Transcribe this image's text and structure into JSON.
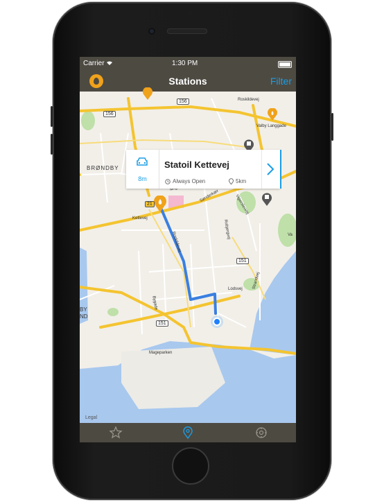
{
  "status_bar": {
    "carrier": "Carrier",
    "time": "1:30 PM"
  },
  "nav": {
    "title": "Stations",
    "filter_label": "Filter"
  },
  "map": {
    "labels": {
      "brondby": "BRØNDBY",
      "brondby_strand_1": "BY",
      "brondby_strand_2": "ND",
      "kettevej": "Kettevej",
      "roskildevej": "Roskildevej",
      "valby_langgade": "Valby Langgade",
      "sonderkaer": "Sønderkær",
      "vigerslevvej": "Vigerslevvej",
      "roskilde_mark": "Roskildevej",
      "lodsvej": "Lodsvej",
      "strandvej": "Strandvej",
      "bygade": "Bygade",
      "mageparken": "Mageparken",
      "va": "Va",
      "roblergvej": "Robjergvej",
      "llingevej": "llingevej"
    },
    "shields": {
      "r156a": "156",
      "r156b": "156",
      "r21": "21",
      "r151a": "151",
      "r151b": "151"
    },
    "legal": "Legal"
  },
  "station_card": {
    "name": "Statoil Kettevej",
    "travel_time": "8m",
    "status": "Always Open",
    "distance": "5km"
  },
  "colors": {
    "accent": "#1a9ee6",
    "brand": "#f0a21b",
    "bar": "#4d4a42",
    "road_major": "#f4c430",
    "water": "#a8c8ee",
    "park": "#bfe0a9"
  },
  "tabs": [
    {
      "icon": "star-icon",
      "active": false
    },
    {
      "icon": "map-pin-icon",
      "active": true
    },
    {
      "icon": "settings-icon",
      "active": false
    }
  ]
}
